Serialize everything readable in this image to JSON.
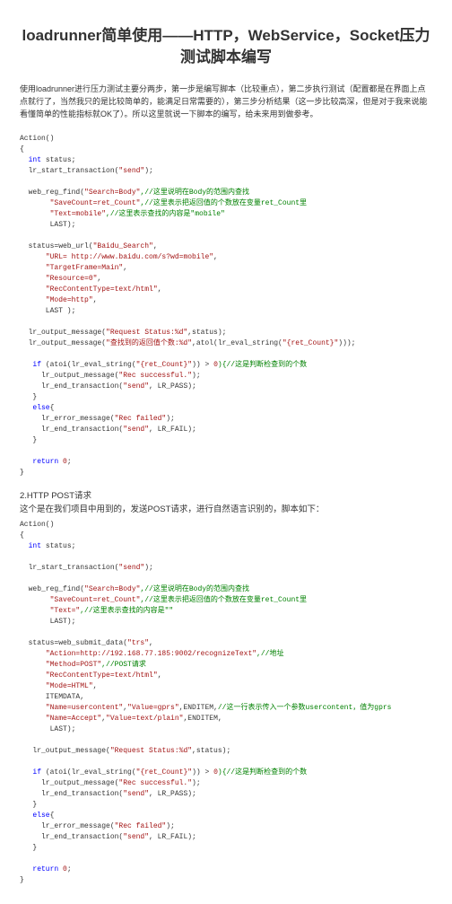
{
  "title": "loadrunner简单使⽤——HTTP，WebService，Socket压⼒测试脚本编写",
  "intro": "使⽤loadrunner进⾏压⼒测试主要分两步，第⼀步是编写脚本（⽐较重点），第⼆步执⾏测试（配置都是在界⾯上点点就⾏了，当然我只的是⽐较简单的，能满⾜⽇常需要的），第三步分析结果（这⼀步⽐较⾼深，但是对于我来说能看懂简单的性能指标就OK了）。所以这⾥就说⼀下脚本的编写，给未来⽤到做参考。",
  "section2_num": "2.HTTP POST请求",
  "section2_desc": "这个是在我们项⽬中⽤到的，发送POST请求，进⾏⾃然语⾔识别的，脚本如下：",
  "c": {
    "action": "Action()",
    "int": "int",
    "status": " status;",
    "lr_start": "  lr_start_transaction(",
    "send": "\"send\"",
    "rparen": ");",
    "web_reg_find": "  web_reg_find(",
    "search_body": "\"Search=Body\"",
    "c_search_body": ",//这⾥说明在Body的范围内查找",
    "savecount": "\"SaveCount=ret_Count\"",
    "c_savecount": ",//这⾥表⽰把返回值的个数放在变量ret_Count⾥",
    "text_mobile": "\"Text=mobile\"",
    "c_text_mobile": ",//这⾥表⽰查找的内容是\"mobile\"",
    "text_empty": "\"Text=\"",
    "c_text_empty": ",//这⾥表⽰查找的内容是\"\"",
    "last": "       LAST);",
    "last2": "      LAST );",
    "web_url": "  status=web_url(",
    "baidu": "\"Baidu_Search\"",
    "url": "\"URL= http://www.baidu.com/s?wd=mobile\"",
    "target": "\"TargetFrame=Main\"",
    "resource": "\"Resource=0\"",
    "reccontent": "\"RecContentType=text/html\"",
    "mode_http": "\"Mode=http\"",
    "mode_html": "\"Mode=HTML\"",
    "lr_out1": "  lr_output_message(",
    "req_status": "\"Request Status:%d\"",
    "status_arg": ",status);",
    "lr_out2": "  lr_output_message(",
    "found_msg": "\"查找到的返回值个数:%d\"",
    "atol_ret": ",atol(lr_eval_string(",
    "ret_count": "\"{ret_Count}\"",
    "if": "if",
    "if_cond": " (atoi(lr_eval_string(",
    "gt0": ")) > ",
    "zero": "0",
    "c_if": "){//这是判断检查到的个数",
    "rec_succ": "\"Rec successful.\"",
    "lr_pass": ", LR_PASS);",
    "else": "else",
    "lr_err": "     lr_error_message(",
    "rec_fail": "\"Rec failed\"",
    "lr_fail": ", LR_FAIL);",
    "return": "return",
    "web_submit": "  status=web_submit_data(",
    "trs": "\"trs\"",
    "action_url": "\"Action=http://192.168.77.185:9002/recognizeText\"",
    "c_addr": ",//地址",
    "method_post": "\"Method=POST\"",
    "c_post": ",//POST请求",
    "itemdata": "      ITEMDATA,",
    "name_user": "\"Name=usercontent\"",
    "value_gprs": "\"Value=gprs\"",
    "enditem": ",ENDITEM,",
    "c_param": "//这⼀行表⽰传⼊⼀个参数usercontent，值为gprs",
    "name_accept": "\"Name=Accept\"",
    "value_plain": "\"Value=text/plain\"",
    "lr_end": "     lr_end_transaction(",
    "lr_out_req": "   lr_output_message(",
    "lr_out_succ": "     lr_output_message("
  }
}
